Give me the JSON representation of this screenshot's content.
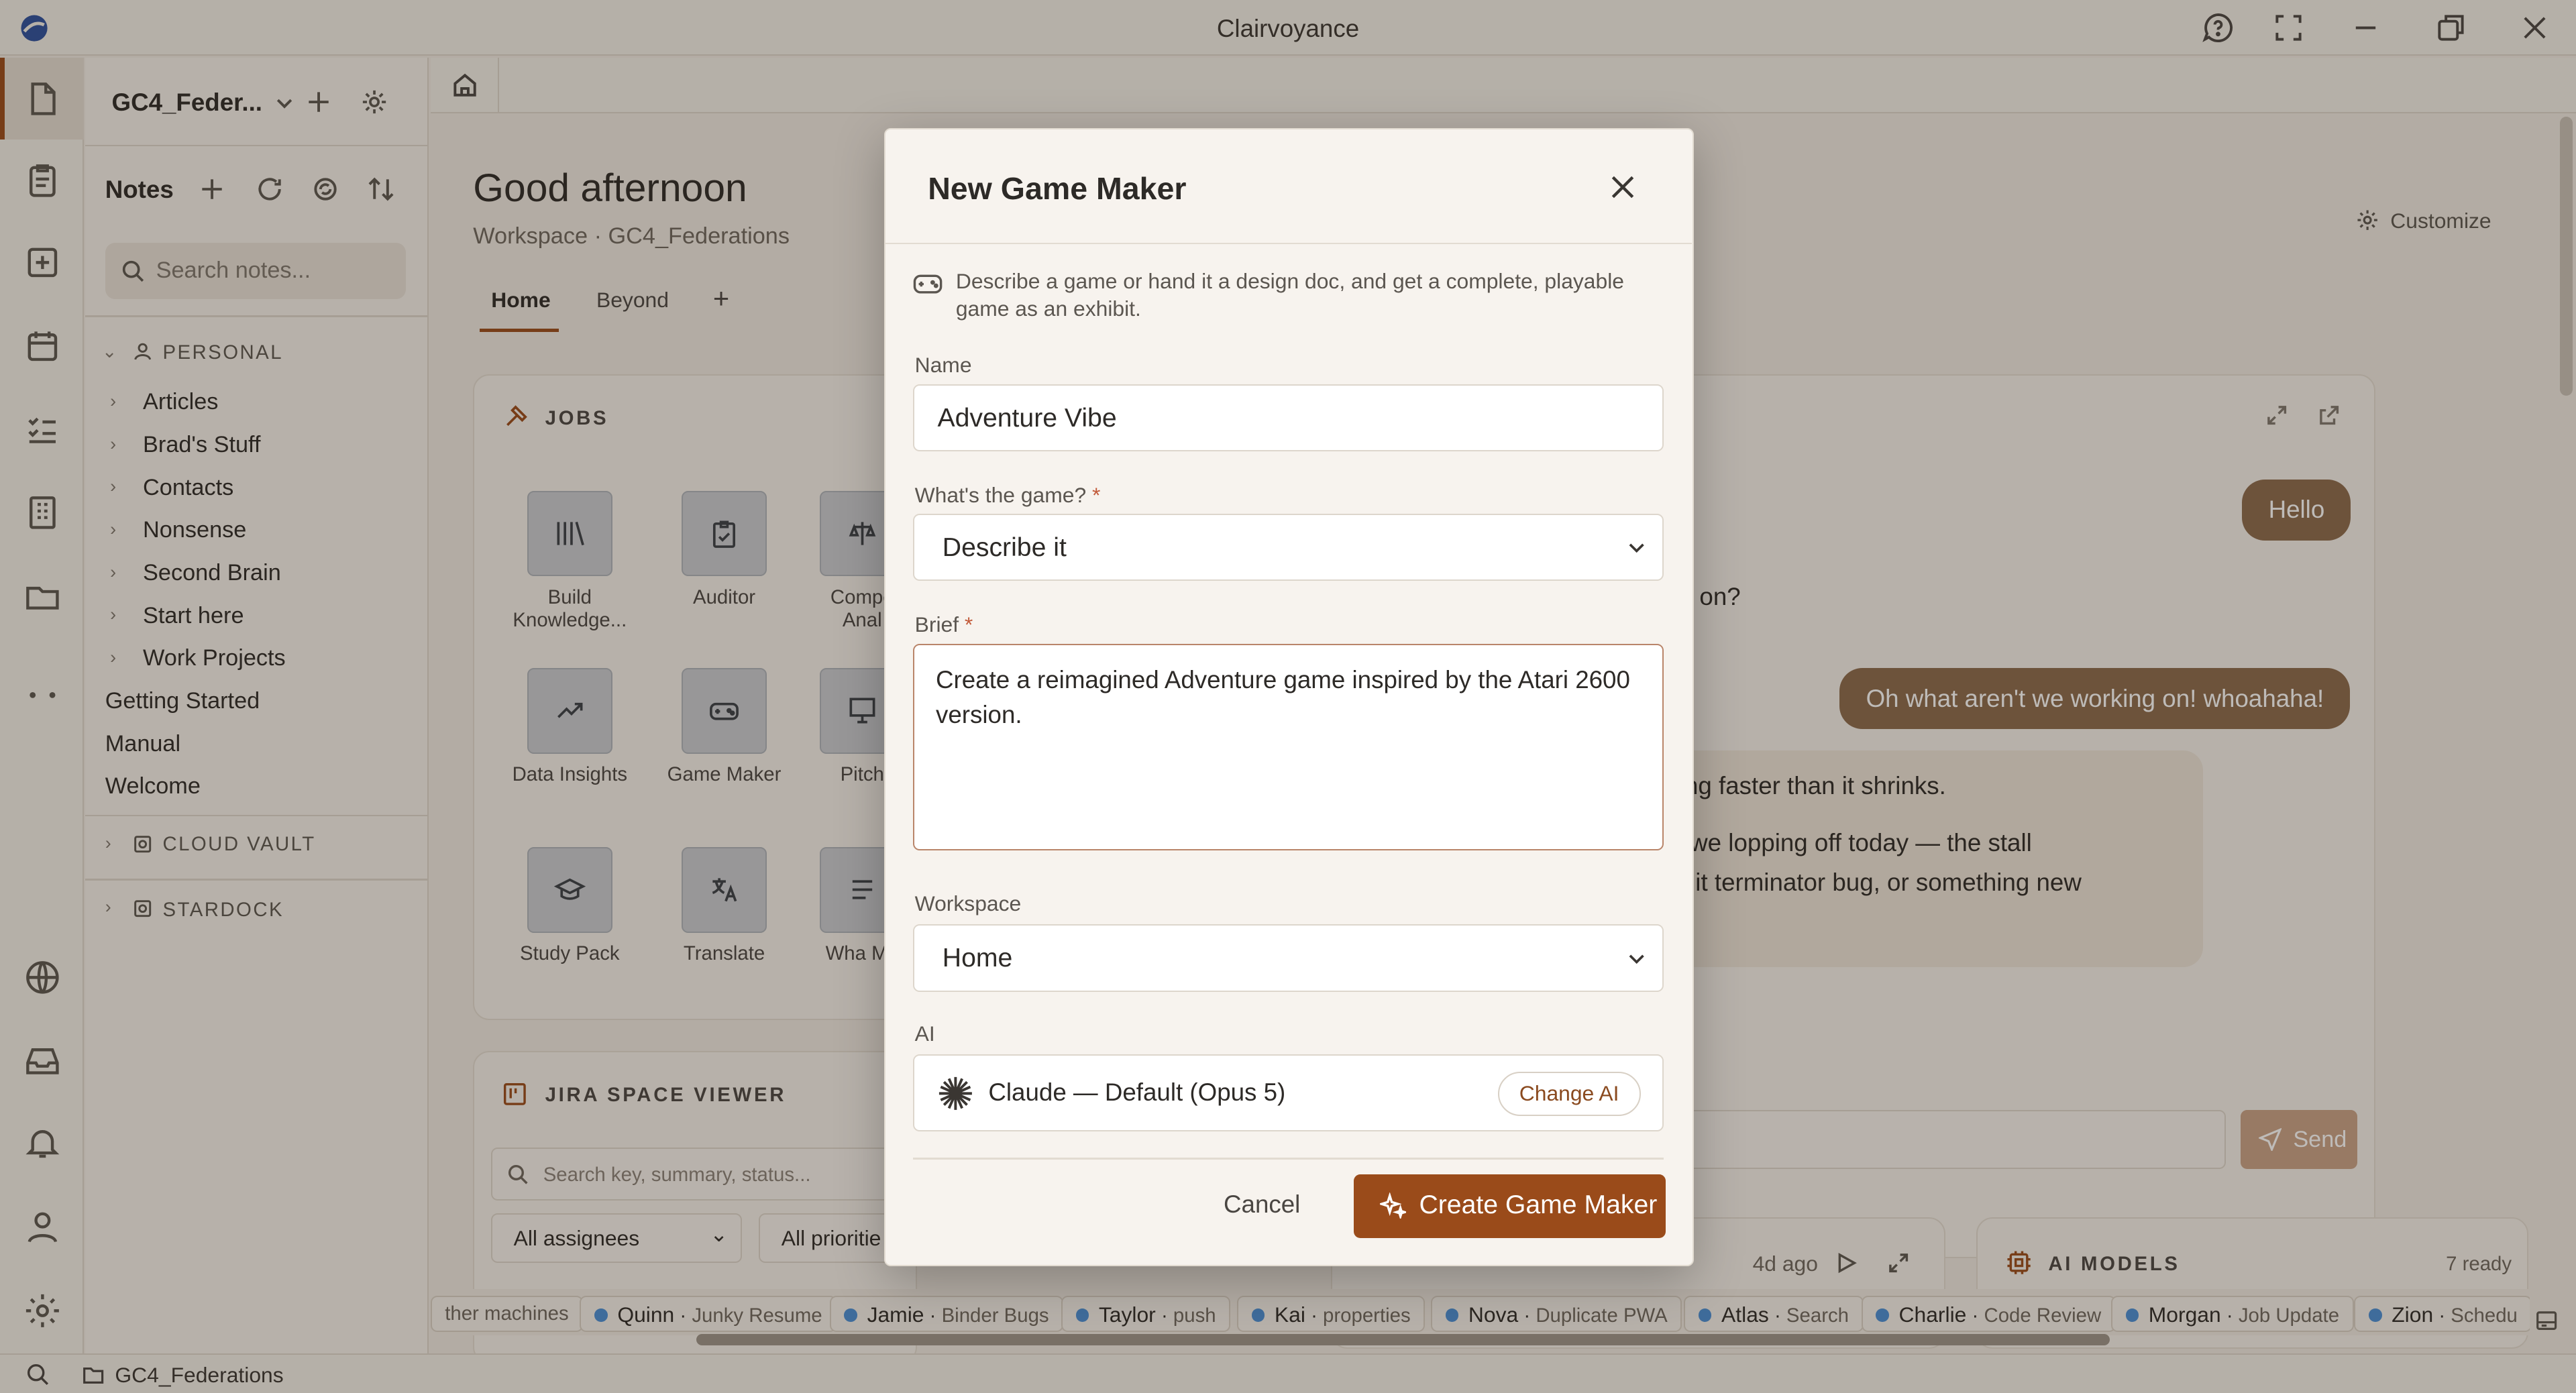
{
  "app": {
    "title": "Clairvoyance"
  },
  "sidebar": {
    "workspace_name": "GC4_Feder...",
    "notes_title": "Notes",
    "search_placeholder": "Search notes...",
    "personal_header": "PERSONAL",
    "folders": [
      "Articles",
      "Brad's Stuff",
      "Contacts",
      "Nonsense",
      "Second Brain",
      "Start here",
      "Work Projects"
    ],
    "pages": [
      "Getting Started",
      "Manual",
      "Welcome"
    ],
    "cloud_vault": "CLOUD VAULT",
    "stardock": "STARDOCK"
  },
  "home": {
    "greeting": "Good afternoon",
    "subtitle": "Workspace · GC4_Federations",
    "tabs": [
      "Home",
      "Beyond"
    ],
    "customize": "Customize",
    "jobs_title": "JOBS",
    "jobs": [
      {
        "label": "Build Knowledge...",
        "icon": "library-icon"
      },
      {
        "label": "Auditor",
        "icon": "clipboard-check-icon"
      },
      {
        "label": "Compe Anal",
        "icon": "scale-icon"
      },
      {
        "label": "Data Insights",
        "icon": "trend-icon"
      },
      {
        "label": "Game Maker",
        "icon": "gamepad-icon"
      },
      {
        "label": "Pitch",
        "icon": "presentation-icon"
      },
      {
        "label": "Study Pack",
        "icon": "graduation-cap-icon"
      },
      {
        "label": "Translate",
        "icon": "translate-icon"
      },
      {
        "label": "Wha Mo",
        "icon": "list-icon"
      }
    ],
    "jira_title": "JIRA SPACE VIEWER",
    "jira_search_placeholder": "Search key, summary, status...",
    "jira_filter_assignees": "All assignees",
    "jira_filter_priorities": "All prioritie",
    "chat": {
      "user_1": "Hello",
      "bot_1": "king on?",
      "user_2": "Oh what aren't we working on! whoahaha!",
      "bot_2_a": "owing faster than it shrinks.",
      "bot_2_b": "are we lopping off today — the stall",
      "bot_2_c": "ecruit terminator bug, or something new",
      "send": "Send"
    },
    "bottom_time": "4d ago",
    "ai_models_title": "AI MODELS",
    "ai_models_status": "7 ready"
  },
  "ticker": [
    {
      "name": "",
      "detail": "ther machines"
    },
    {
      "name": "Quinn",
      "detail": "Junky Resume"
    },
    {
      "name": "Jamie",
      "detail": "Binder Bugs"
    },
    {
      "name": "Taylor",
      "detail": "push"
    },
    {
      "name": "Kai",
      "detail": "properties"
    },
    {
      "name": "Nova",
      "detail": "Duplicate PWA"
    },
    {
      "name": "Atlas",
      "detail": "Search"
    },
    {
      "name": "Charlie",
      "detail": "Code Review"
    },
    {
      "name": "Morgan",
      "detail": "Job Update"
    },
    {
      "name": "Zion",
      "detail": "Schedu"
    }
  ],
  "statusbar": {
    "workspace": "GC4_Federations"
  },
  "modal": {
    "title": "New Game Maker",
    "description": "Describe a game or hand it a design doc, and get a complete, playable game as an exhibit.",
    "name_label": "Name",
    "name_value": "Adventure Vibe",
    "game_label": "What's the game?",
    "game_value": "Describe it",
    "brief_label": "Brief",
    "brief_value": "Create a reimagined Adventure game inspired by the Atari 2600 version.",
    "workspace_label": "Workspace",
    "workspace_value": "Home",
    "ai_label": "AI",
    "ai_value": "Claude — Default (Opus 5)",
    "change_ai": "Change AI",
    "cancel": "Cancel",
    "create": "Create Game Maker"
  },
  "colors": {
    "accent": "#9a4b1a",
    "chat_bubble": "#8b6a4d",
    "ticker_dot": "#4a8fd6"
  }
}
